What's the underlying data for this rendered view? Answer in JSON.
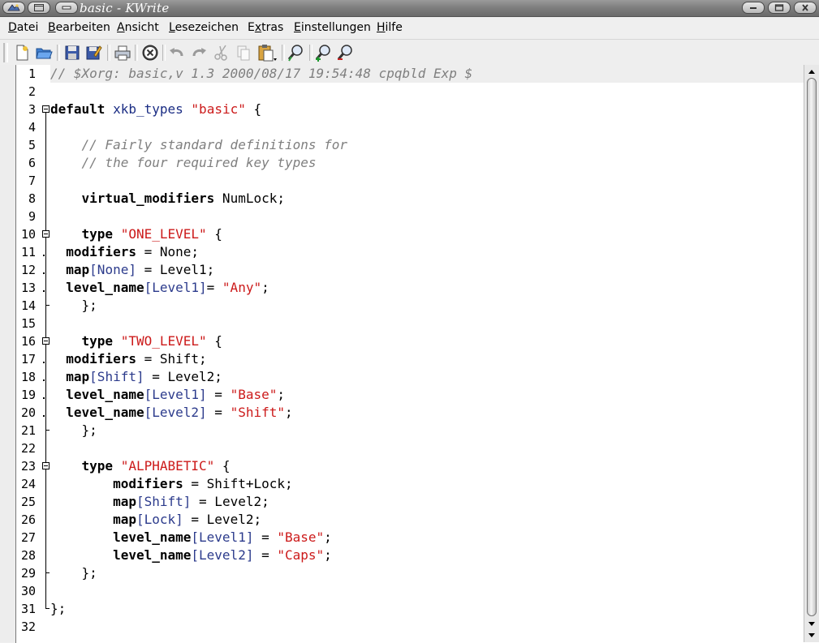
{
  "window": {
    "title": "basic - KWrite"
  },
  "menubar": [
    {
      "pre": "",
      "acc": "D",
      "post": "atei"
    },
    {
      "pre": "",
      "acc": "B",
      "post": "earbeiten"
    },
    {
      "pre": "",
      "acc": "A",
      "post": "nsicht"
    },
    {
      "pre": "",
      "acc": "L",
      "post": "esezeichen"
    },
    {
      "pre": "E",
      "acc": "x",
      "post": "tras"
    },
    {
      "pre": "",
      "acc": "E",
      "post": "instellungen"
    },
    {
      "pre": "",
      "acc": "H",
      "post": "ilfe"
    }
  ],
  "toolbar": {
    "icons": [
      "new-file-icon",
      "open-file-icon",
      "save-icon",
      "save-as-icon",
      "print-icon",
      "close-document-icon",
      "undo-icon",
      "redo-icon",
      "cut-icon",
      "copy-icon",
      "paste-icon",
      "find-icon",
      "zoom-in-icon",
      "zoom-out-icon"
    ]
  },
  "editor": {
    "line_numbers": [
      "1",
      "2",
      "3",
      "4",
      "5",
      "6",
      "7",
      "8",
      "9",
      "10",
      "11",
      "12",
      "13",
      "14",
      "15",
      "16",
      "17",
      "18",
      "19",
      "20",
      "21",
      "22",
      "23",
      "24",
      "25",
      "26",
      "27",
      "28",
      "29",
      "30",
      "31",
      "32"
    ],
    "current_line": 1,
    "lines": [
      [
        {
          "t": "// $Xorg: basic,v 1.3 2000/08/17 19:54:48 cpqbld Exp $",
          "c": "comment"
        }
      ],
      [],
      [
        {
          "t": "default",
          "c": "key"
        },
        {
          "t": " "
        },
        {
          "t": "xkb_types",
          "c": "type"
        },
        {
          "t": " "
        },
        {
          "t": "\"basic\"",
          "c": "str"
        },
        {
          "t": " {"
        }
      ],
      [],
      [
        {
          "t": "    "
        },
        {
          "t": "// Fairly standard definitions for",
          "c": "comment"
        }
      ],
      [
        {
          "t": "    "
        },
        {
          "t": "// the four required key types",
          "c": "comment"
        }
      ],
      [],
      [
        {
          "t": "    "
        },
        {
          "t": "virtual_modifiers",
          "c": "key"
        },
        {
          "t": " NumLock;"
        }
      ],
      [],
      [
        {
          "t": "    "
        },
        {
          "t": "type",
          "c": "key"
        },
        {
          "t": " "
        },
        {
          "t": "\"ONE_LEVEL\"",
          "c": "str"
        },
        {
          "t": " {"
        }
      ],
      [
        {
          "t": "  "
        },
        {
          "t": "modifiers",
          "c": "key"
        },
        {
          "t": " = None;"
        }
      ],
      [
        {
          "t": "  "
        },
        {
          "t": "map",
          "c": "key"
        },
        {
          "t": "[None]",
          "c": "idx"
        },
        {
          "t": " = Level1;"
        }
      ],
      [
        {
          "t": "  "
        },
        {
          "t": "level_name",
          "c": "key"
        },
        {
          "t": "[Level1]",
          "c": "idx"
        },
        {
          "t": "= "
        },
        {
          "t": "\"Any\"",
          "c": "str"
        },
        {
          "t": ";"
        }
      ],
      [
        {
          "t": "    };"
        }
      ],
      [],
      [
        {
          "t": "    "
        },
        {
          "t": "type",
          "c": "key"
        },
        {
          "t": " "
        },
        {
          "t": "\"TWO_LEVEL\"",
          "c": "str"
        },
        {
          "t": " {"
        }
      ],
      [
        {
          "t": "  "
        },
        {
          "t": "modifiers",
          "c": "key"
        },
        {
          "t": " = Shift;"
        }
      ],
      [
        {
          "t": "  "
        },
        {
          "t": "map",
          "c": "key"
        },
        {
          "t": "[Shift]",
          "c": "idx"
        },
        {
          "t": " = Level2;"
        }
      ],
      [
        {
          "t": "  "
        },
        {
          "t": "level_name",
          "c": "key"
        },
        {
          "t": "[Level1]",
          "c": "idx"
        },
        {
          "t": " = "
        },
        {
          "t": "\"Base\"",
          "c": "str"
        },
        {
          "t": ";"
        }
      ],
      [
        {
          "t": "  "
        },
        {
          "t": "level_name",
          "c": "key"
        },
        {
          "t": "[Level2]",
          "c": "idx"
        },
        {
          "t": " = "
        },
        {
          "t": "\"Shift\"",
          "c": "str"
        },
        {
          "t": ";"
        }
      ],
      [
        {
          "t": "    };"
        }
      ],
      [],
      [
        {
          "t": "    "
        },
        {
          "t": "type",
          "c": "key"
        },
        {
          "t": " "
        },
        {
          "t": "\"ALPHABETIC\"",
          "c": "str"
        },
        {
          "t": " {"
        }
      ],
      [
        {
          "t": "        "
        },
        {
          "t": "modifiers",
          "c": "key"
        },
        {
          "t": " = Shift+Lock;"
        }
      ],
      [
        {
          "t": "        "
        },
        {
          "t": "map",
          "c": "key"
        },
        {
          "t": "[Shift]",
          "c": "idx"
        },
        {
          "t": " = Level2;"
        }
      ],
      [
        {
          "t": "        "
        },
        {
          "t": "map",
          "c": "key"
        },
        {
          "t": "[Lock]",
          "c": "idx"
        },
        {
          "t": " = Level2;"
        }
      ],
      [
        {
          "t": "        "
        },
        {
          "t": "level_name",
          "c": "key"
        },
        {
          "t": "[Level1]",
          "c": "idx"
        },
        {
          "t": " = "
        },
        {
          "t": "\"Base\"",
          "c": "str"
        },
        {
          "t": ";"
        }
      ],
      [
        {
          "t": "        "
        },
        {
          "t": "level_name",
          "c": "key"
        },
        {
          "t": "[Level2]",
          "c": "idx"
        },
        {
          "t": " = "
        },
        {
          "t": "\"Caps\"",
          "c": "str"
        },
        {
          "t": ";"
        }
      ],
      [
        {
          "t": "    };"
        }
      ],
      [],
      [
        {
          "t": "};"
        }
      ],
      []
    ]
  }
}
